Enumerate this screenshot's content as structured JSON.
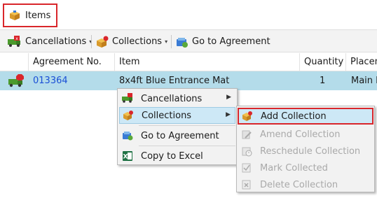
{
  "title_tab": {
    "label": "Items",
    "icon": "box-icon"
  },
  "toolbar": {
    "cancellations_label": "Cancellations",
    "collections_label": "Collections",
    "go_to_agreement_label": "Go to Agreement",
    "dropdown_caret": "▾"
  },
  "grid": {
    "columns": [
      "Agreement No.",
      "Item",
      "Quantity",
      "Placem"
    ],
    "row": {
      "agreement_no": "013364",
      "item": "8x4ft Blue Entrance Mat",
      "quantity": "1",
      "placement": "Main I"
    }
  },
  "context_menu": {
    "items": [
      {
        "label": "Cancellations",
        "has_submenu": true
      },
      {
        "label": "Collections",
        "has_submenu": true,
        "highlighted": true
      },
      {
        "label": "Go to Agreement"
      },
      {
        "label": "Copy to Excel"
      }
    ],
    "submenu_arrow": "▶"
  },
  "submenu": {
    "items": [
      {
        "label": "Add Collection",
        "enabled": true,
        "highlighted": true
      },
      {
        "label": "Amend Collection",
        "enabled": false
      },
      {
        "label": "Reschedule Collection",
        "enabled": false
      },
      {
        "label": "Mark Collected",
        "enabled": false
      },
      {
        "label": "Delete Collection",
        "enabled": false
      }
    ]
  },
  "colors": {
    "highlight_border": "#d9262b",
    "row_selected": "#b4dcea",
    "link": "#1a4fd6",
    "menu_highlight": "#cde8f6"
  }
}
